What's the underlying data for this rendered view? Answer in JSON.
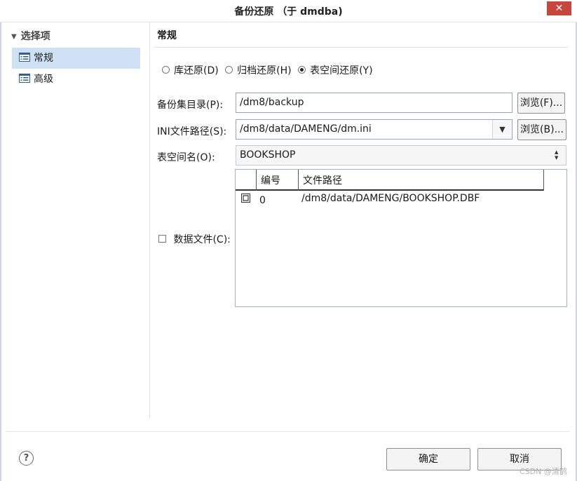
{
  "window": {
    "title": "备份还原 （于 dmdba)",
    "close_glyph": "✕"
  },
  "sidebar": {
    "root_label": "选择项",
    "items": [
      {
        "label": "常规",
        "selected": true
      },
      {
        "label": "高级",
        "selected": false
      }
    ]
  },
  "main": {
    "section_title": "常规",
    "restore_type": {
      "options": [
        "库还原(D)",
        "归档还原(H)",
        "表空间还原(Y)"
      ],
      "selected": "表空间还原(Y)"
    },
    "backup_dir": {
      "label": "备份集目录(P):",
      "value": "/dm8/backup",
      "browse_label": "浏览(F)..."
    },
    "ini_path": {
      "label": "INI文件路径(S):",
      "value": "/dm8/data/DAMENG/dm.ini",
      "browse_label": "浏览(B)..."
    },
    "tablespace": {
      "label": "表空间名(O):",
      "value": "BOOKSHOP"
    },
    "datafile": {
      "label": "数据文件(C):",
      "checked": false,
      "columns": [
        "编号",
        "文件路径"
      ],
      "rows": [
        {
          "checked": true,
          "number": "0",
          "path": "/dm8/data/DAMENG/BOOKSHOP.DBF"
        }
      ]
    }
  },
  "footer": {
    "help_glyph": "?",
    "ok_label": "确定",
    "cancel_label": "取消"
  },
  "watermark": "CSDN @清鹊",
  "colors": {
    "close_button": "#c9463d",
    "selection": "#cfe2f5"
  }
}
